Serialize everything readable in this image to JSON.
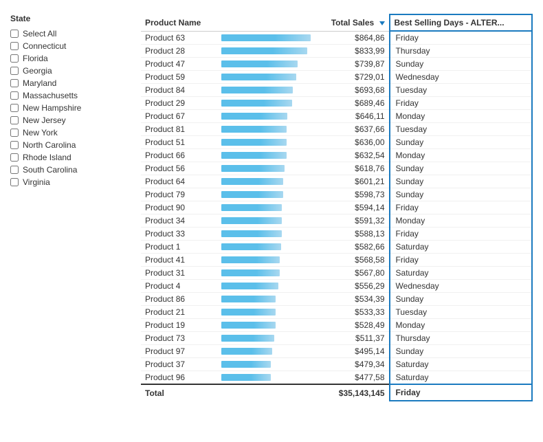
{
  "sidebar": {
    "title": "State",
    "items": [
      {
        "label": "Select All",
        "checked": false
      },
      {
        "label": "Connecticut",
        "checked": false
      },
      {
        "label": "Florida",
        "checked": false
      },
      {
        "label": "Georgia",
        "checked": false
      },
      {
        "label": "Maryland",
        "checked": false
      },
      {
        "label": "Massachusetts",
        "checked": false
      },
      {
        "label": "New Hampshire",
        "checked": false
      },
      {
        "label": "New Jersey",
        "checked": false
      },
      {
        "label": "New York",
        "checked": false
      },
      {
        "label": "North Carolina",
        "checked": false
      },
      {
        "label": "Rhode Island",
        "checked": false
      },
      {
        "label": "South Carolina",
        "checked": false
      },
      {
        "label": "Virginia",
        "checked": false
      }
    ]
  },
  "table": {
    "columns": {
      "product": "Product Name",
      "sales": "Total Sales",
      "day": "Best Selling Days - ALTER..."
    },
    "rows": [
      {
        "product": "Product 63",
        "sales": "$864,86",
        "bar": 100,
        "day": "Friday"
      },
      {
        "product": "Product 28",
        "sales": "$833,99",
        "bar": 96,
        "day": "Thursday"
      },
      {
        "product": "Product 47",
        "sales": "$739,87",
        "bar": 85,
        "day": "Sunday"
      },
      {
        "product": "Product 59",
        "sales": "$729,01",
        "bar": 84,
        "day": "Wednesday"
      },
      {
        "product": "Product 84",
        "sales": "$693,68",
        "bar": 80,
        "day": "Tuesday"
      },
      {
        "product": "Product 29",
        "sales": "$689,46",
        "bar": 79,
        "day": "Friday"
      },
      {
        "product": "Product 67",
        "sales": "$646,11",
        "bar": 74,
        "day": "Monday"
      },
      {
        "product": "Product 81",
        "sales": "$637,66",
        "bar": 73,
        "day": "Tuesday"
      },
      {
        "product": "Product 51",
        "sales": "$636,00",
        "bar": 73,
        "day": "Sunday"
      },
      {
        "product": "Product 66",
        "sales": "$632,54",
        "bar": 73,
        "day": "Monday"
      },
      {
        "product": "Product 56",
        "sales": "$618,76",
        "bar": 71,
        "day": "Sunday"
      },
      {
        "product": "Product 64",
        "sales": "$601,21",
        "bar": 69,
        "day": "Sunday"
      },
      {
        "product": "Product 79",
        "sales": "$598,73",
        "bar": 69,
        "day": "Sunday"
      },
      {
        "product": "Product 90",
        "sales": "$594,14",
        "bar": 68,
        "day": "Friday"
      },
      {
        "product": "Product 34",
        "sales": "$591,32",
        "bar": 68,
        "day": "Monday"
      },
      {
        "product": "Product 33",
        "sales": "$588,13",
        "bar": 68,
        "day": "Friday"
      },
      {
        "product": "Product 1",
        "sales": "$582,66",
        "bar": 67,
        "day": "Saturday"
      },
      {
        "product": "Product 41",
        "sales": "$568,58",
        "bar": 65,
        "day": "Friday"
      },
      {
        "product": "Product 31",
        "sales": "$567,80",
        "bar": 65,
        "day": "Saturday"
      },
      {
        "product": "Product 4",
        "sales": "$556,29",
        "bar": 64,
        "day": "Wednesday"
      },
      {
        "product": "Product 86",
        "sales": "$534,39",
        "bar": 61,
        "day": "Sunday"
      },
      {
        "product": "Product 21",
        "sales": "$533,33",
        "bar": 61,
        "day": "Tuesday"
      },
      {
        "product": "Product 19",
        "sales": "$528,49",
        "bar": 61,
        "day": "Monday"
      },
      {
        "product": "Product 73",
        "sales": "$511,37",
        "bar": 59,
        "day": "Thursday"
      },
      {
        "product": "Product 97",
        "sales": "$495,14",
        "bar": 57,
        "day": "Sunday"
      },
      {
        "product": "Product 37",
        "sales": "$479,34",
        "bar": 55,
        "day": "Saturday"
      },
      {
        "product": "Product 96",
        "sales": "$477,58",
        "bar": 55,
        "day": "Saturday"
      }
    ],
    "footer": {
      "label": "Total",
      "sales": "$35,143,145",
      "day": "Friday"
    }
  }
}
